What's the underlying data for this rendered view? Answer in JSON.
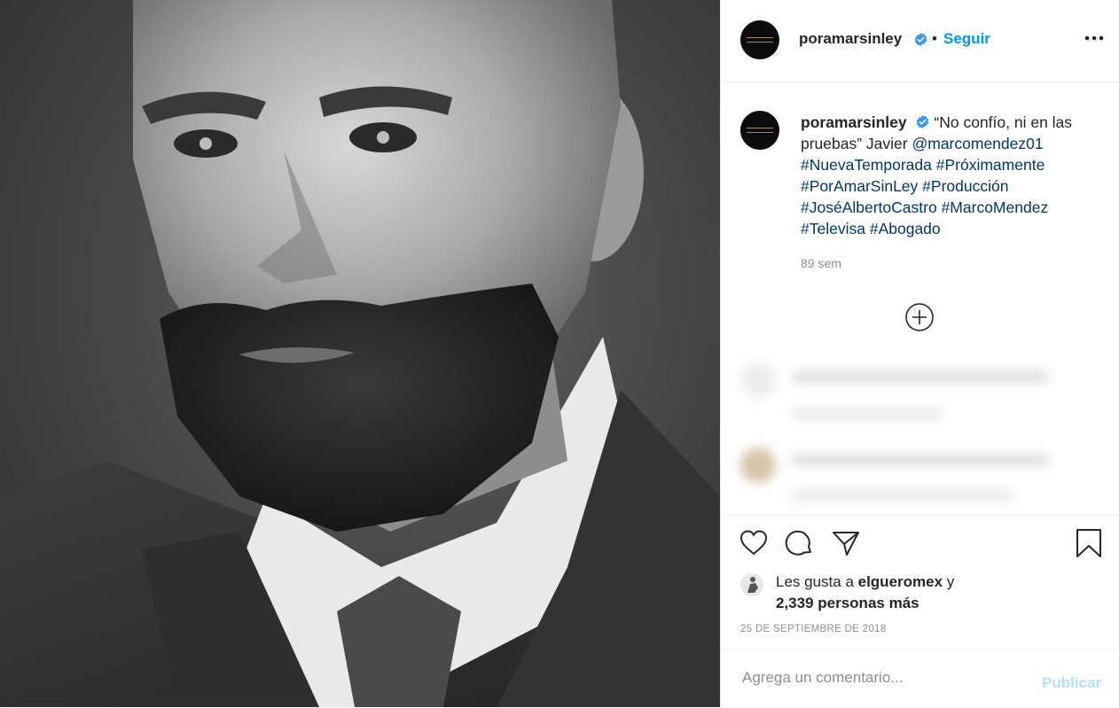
{
  "post": {
    "header": {
      "username": "poramarsinley",
      "separator": "•",
      "follow_label": "Seguir",
      "verified": true
    },
    "caption": {
      "username": "poramarsinley",
      "text_start": "“No confío, ni en las pruebas” Javier ",
      "mention": "@marcomendez01",
      "hashtags": [
        "#NuevaTemporada",
        "#Próximamente",
        "#PorAmarSinLey",
        "#Producción",
        "#JoséAlbertoCastro",
        "#MarcoMendez",
        "#Televisa",
        "#Abogado"
      ],
      "time_ago": "89 sem"
    },
    "likes": {
      "prefix": "Les gusta a ",
      "liker": "elgueromex",
      "conjunction": " y",
      "others": "2,339 personas más"
    },
    "date": "25 DE SEPTIEMBRE DE 2018",
    "comment_box": {
      "placeholder": "Agrega un comentario...",
      "publish_label": "Publicar"
    }
  },
  "colors": {
    "accent": "#0095f6",
    "tag": "#00376b",
    "muted": "#8e8e8e",
    "publish_disabled": "#b2dffc",
    "divider": "#efefef"
  },
  "icons": [
    "verified-badge-icon",
    "more-options-icon",
    "load-comments-icon",
    "heart-icon",
    "comment-icon",
    "share-icon",
    "bookmark-icon"
  ]
}
